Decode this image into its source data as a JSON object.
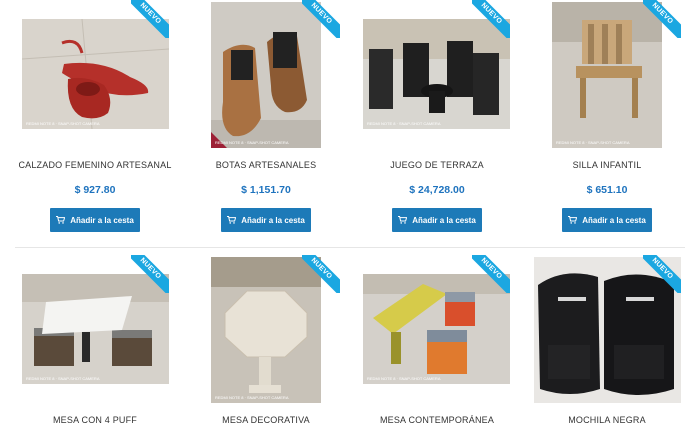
{
  "badge_label": "NUEVO",
  "watermark_text": "REDMI NOTE 8 · SNAP-SHOT CAMERA",
  "cart_icon": "cart-icon",
  "accent_color": "#1e73be",
  "ribbon_color": "#1ba7e1",
  "products": [
    {
      "title": "CALZADO FEMENINO ARTESANAL",
      "price": "$ 927.80",
      "button": "Añadir a la cesta"
    },
    {
      "title": "BOTAS ARTESANALES",
      "price": "$ 1,151.70",
      "button": "Añadir a la cesta"
    },
    {
      "title": "JUEGO DE TERRAZA",
      "price": "$ 24,728.00",
      "button": "Añadir a la cesta"
    },
    {
      "title": "SILLA INFANTIL",
      "price": "$ 651.10",
      "button": "Añadir a la cesta"
    },
    {
      "title": "MESA CON 4 PUFF"
    },
    {
      "title": "MESA DECORATIVA"
    },
    {
      "title": "MESA CONTEMPORÁNEA"
    },
    {
      "title": "MOCHILA NEGRA"
    }
  ]
}
